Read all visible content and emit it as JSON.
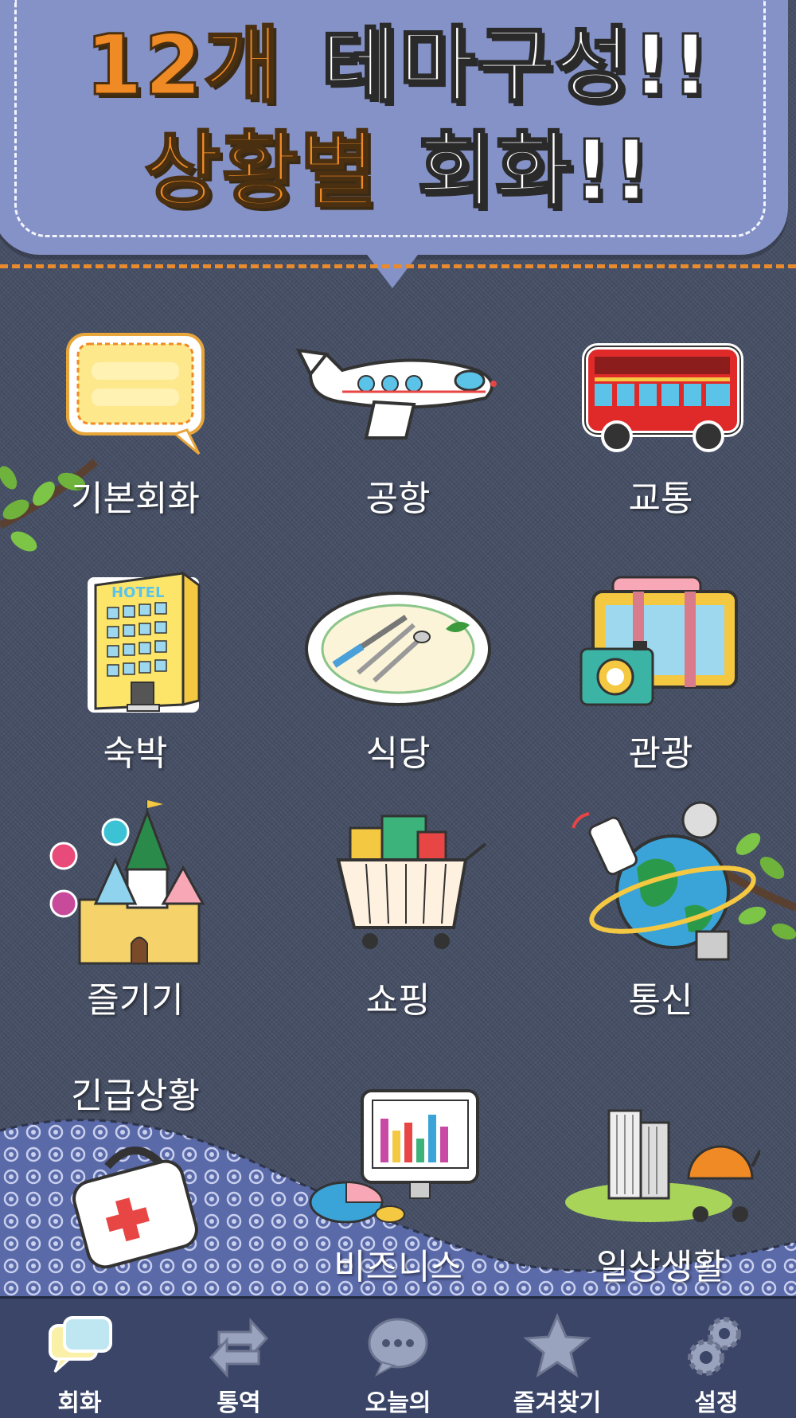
{
  "banner": {
    "line1_highlight": "12개",
    "line1_text": "테마구성!!",
    "line2_highlight": "상황별",
    "line2_text": "회화!!"
  },
  "themes": [
    {
      "label": "기본회화",
      "icon": "speech-bubble-icon"
    },
    {
      "label": "공항",
      "icon": "airplane-icon"
    },
    {
      "label": "교통",
      "icon": "bus-icon"
    },
    {
      "label": "숙박",
      "icon": "hotel-icon"
    },
    {
      "label": "식당",
      "icon": "plate-cutlery-icon"
    },
    {
      "label": "관광",
      "icon": "suitcase-camera-icon"
    },
    {
      "label": "즐기기",
      "icon": "castle-ferris-wheel-icon"
    },
    {
      "label": "쇼핑",
      "icon": "shopping-cart-icon"
    },
    {
      "label": "통신",
      "icon": "globe-phone-icon"
    },
    {
      "label": "긴급상황",
      "icon": "first-aid-kit-icon"
    },
    {
      "label": "비즈니스",
      "icon": "monitor-chart-icon"
    },
    {
      "label": "일상생활",
      "icon": "city-stroller-icon"
    }
  ],
  "hotel_sign": "HOTEL",
  "tabs": [
    {
      "label": "회화",
      "icon": "chat-bubbles-icon",
      "active": true
    },
    {
      "label": "통역",
      "icon": "swap-arrows-icon",
      "active": false
    },
    {
      "label": "오늘의",
      "icon": "speech-dots-icon",
      "active": false
    },
    {
      "label": "즐겨찾기",
      "icon": "star-icon",
      "active": false
    },
    {
      "label": "설정",
      "icon": "gears-icon",
      "active": false
    }
  ],
  "colors": {
    "background": "#444d63",
    "banner": "#8592c7",
    "accent_orange": "#f08a25",
    "tabbar": "#3a4568"
  }
}
